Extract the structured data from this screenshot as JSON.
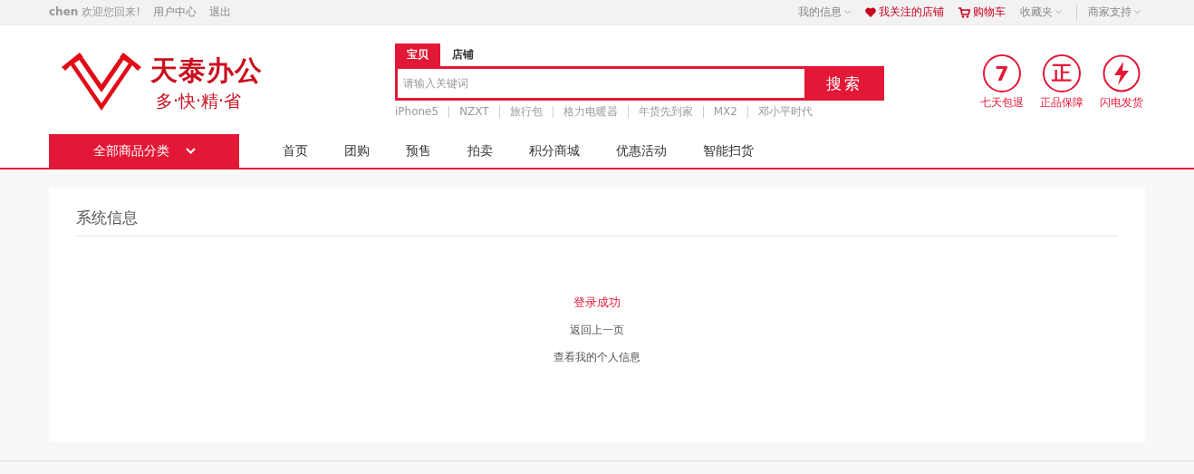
{
  "top_bar": {
    "user": "chen",
    "welcome": "欢迎您回来!",
    "left_links": [
      "用户中心",
      "退出"
    ],
    "right_links": [
      {
        "label": "我的信息",
        "kind": "dropdown"
      },
      {
        "label": "我关注的店铺",
        "kind": "heart"
      },
      {
        "label": "购物车",
        "kind": "cart"
      },
      {
        "label": "收藏夹",
        "kind": "dropdown"
      },
      {
        "label": "商家支持",
        "kind": "dropdown"
      }
    ]
  },
  "logo": {
    "name": "天泰办公",
    "slogan": "多·快·精·省"
  },
  "search": {
    "tabs": [
      {
        "label": "宝贝",
        "selected": true
      },
      {
        "label": "店铺",
        "selected": false
      }
    ],
    "placeholder": "请输入关键词",
    "button": "搜索",
    "hot_words": [
      "iPhone5",
      "NZXT",
      "旅行包",
      "格力电暖器",
      "年货先到家",
      "MX2",
      "邓小平时代"
    ]
  },
  "guarantees": [
    {
      "kind": "text",
      "symbol": "7",
      "label": "七天包退"
    },
    {
      "kind": "text",
      "symbol": "正",
      "label": "正品保障"
    },
    {
      "kind": "bolt",
      "label": "闪电发货"
    }
  ],
  "nav": {
    "category_button": "全部商品分类",
    "items": [
      "首页",
      "团购",
      "预售",
      "拍卖",
      "积分商城",
      "优惠活动",
      "智能扫货"
    ]
  },
  "panel": {
    "title": "系统信息",
    "message": "登录成功",
    "links": [
      "返回上一页",
      "查看我的个人信息"
    ]
  }
}
